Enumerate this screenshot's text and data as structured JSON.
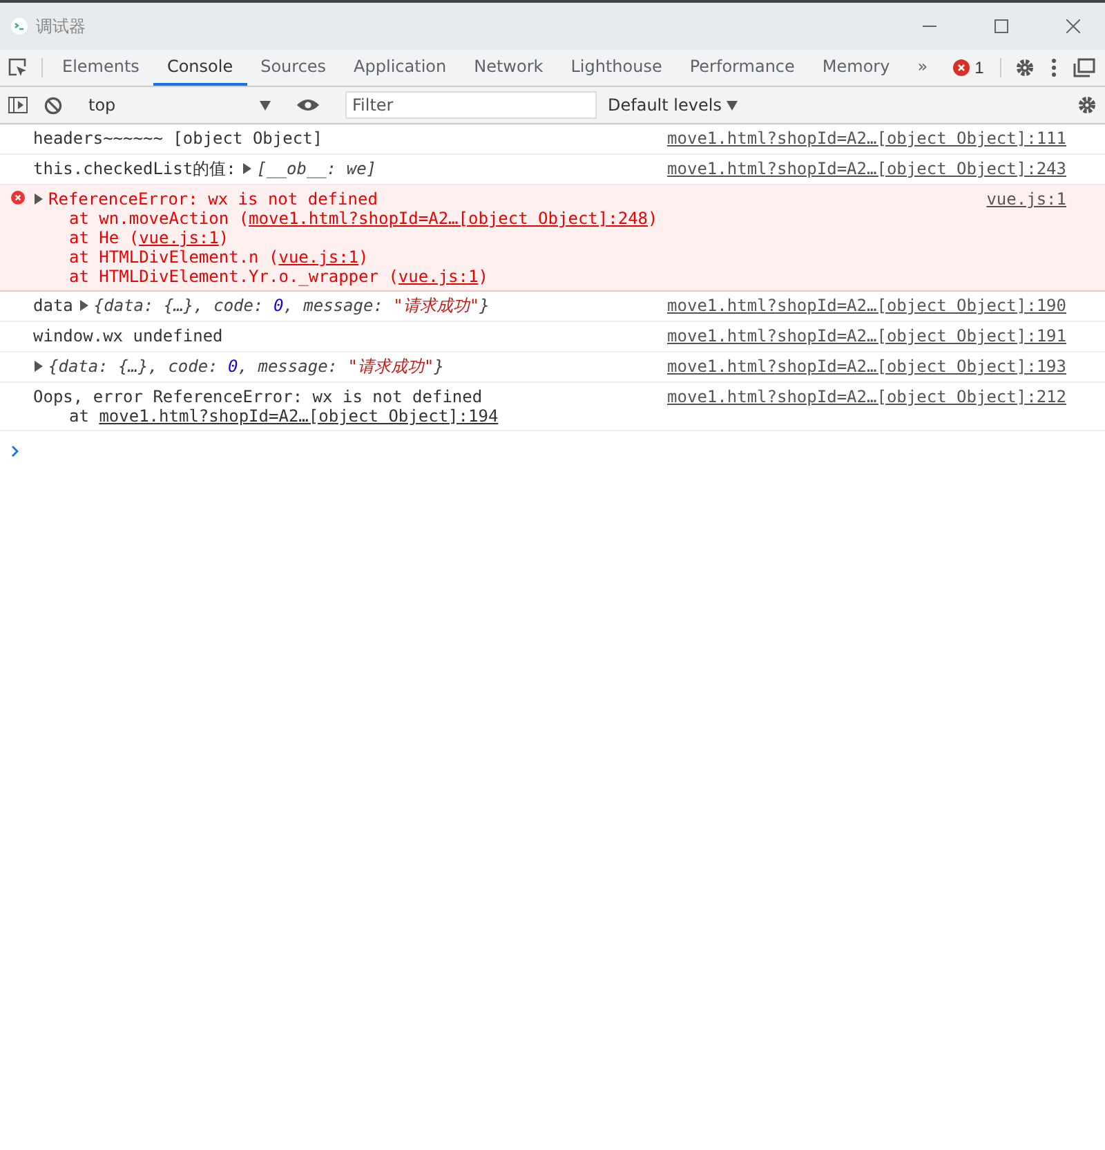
{
  "window": {
    "title": "调试器"
  },
  "tabs": [
    {
      "label": "Elements",
      "selected": false
    },
    {
      "label": "Console",
      "selected": true
    },
    {
      "label": "Sources",
      "selected": false
    },
    {
      "label": "Application",
      "selected": false
    },
    {
      "label": "Network",
      "selected": false
    },
    {
      "label": "Lighthouse",
      "selected": false
    },
    {
      "label": "Performance",
      "selected": false
    },
    {
      "label": "Memory",
      "selected": false
    }
  ],
  "more_tabs": "»",
  "error_count": "1",
  "console_toolbar": {
    "context": "top",
    "filter": {
      "placeholder": "Filter"
    },
    "levels": "Default levels"
  },
  "messages": [
    {
      "error": false,
      "source": "move1.html?shopId=A2…[object Object]:111",
      "lines": [
        [
          {
            "kind": "text",
            "text": "headers~~~~~~ [object Object]"
          }
        ]
      ]
    },
    {
      "error": false,
      "source": "move1.html?shopId=A2…[object Object]:243",
      "lines": [
        [
          {
            "kind": "text",
            "text": "this.checkedList的值:"
          },
          {
            "kind": "expander",
            "expanded": false
          },
          {
            "kind": "preview",
            "text": "[__ob__: we]"
          }
        ]
      ]
    },
    {
      "error": true,
      "source": "vue.js:1",
      "lines": [
        [
          {
            "kind": "expander",
            "expanded": false
          },
          {
            "kind": "text",
            "text": "ReferenceError: wx is not defined"
          }
        ],
        [
          {
            "kind": "text",
            "text": "at wn.moveAction ("
          },
          {
            "kind": "link",
            "text": "move1.html?shopId=A2…[object Object]:248"
          },
          {
            "kind": "text",
            "text": ")"
          }
        ],
        [
          {
            "kind": "text",
            "text": "at He ("
          },
          {
            "kind": "link",
            "text": "vue.js:1"
          },
          {
            "kind": "text",
            "text": ")"
          }
        ],
        [
          {
            "kind": "text",
            "text": "at HTMLDivElement.n ("
          },
          {
            "kind": "link",
            "text": "vue.js:1"
          },
          {
            "kind": "text",
            "text": ")"
          }
        ],
        [
          {
            "kind": "text",
            "text": "at HTMLDivElement.Yr.o._wrapper ("
          },
          {
            "kind": "link",
            "text": "vue.js:1"
          },
          {
            "kind": "text",
            "text": ")"
          }
        ]
      ]
    },
    {
      "error": false,
      "source": "move1.html?shopId=A2…[object Object]:190",
      "lines": [
        [
          {
            "kind": "text",
            "text": "data"
          },
          {
            "kind": "expander",
            "expanded": false
          },
          {
            "kind": "preview",
            "text": "{data: {…}, code: "
          },
          {
            "kind": "number",
            "text": "0"
          },
          {
            "kind": "preview",
            "text": ", message: "
          },
          {
            "kind": "string",
            "text": "\"请求成功\""
          },
          {
            "kind": "preview",
            "text": "}"
          }
        ]
      ]
    },
    {
      "error": false,
      "source": "move1.html?shopId=A2…[object Object]:191",
      "lines": [
        [
          {
            "kind": "text",
            "text": "window.wx undefined"
          }
        ]
      ]
    },
    {
      "error": false,
      "source": "move1.html?shopId=A2…[object Object]:193",
      "lines": [
        [
          {
            "kind": "expander",
            "expanded": false
          },
          {
            "kind": "preview",
            "text": "{data: {…}, code: "
          },
          {
            "kind": "number",
            "text": "0"
          },
          {
            "kind": "preview",
            "text": ", message: "
          },
          {
            "kind": "string",
            "text": "\"请求成功\""
          },
          {
            "kind": "preview",
            "text": "}"
          }
        ]
      ]
    },
    {
      "error": false,
      "source": "move1.html?shopId=A2…[object Object]:212",
      "lines": [
        [
          {
            "kind": "text",
            "text": "Oops, error ReferenceError: wx is not defined"
          }
        ],
        [
          {
            "kind": "text",
            "text": "at "
          },
          {
            "kind": "link",
            "text": "move1.html?shopId=A2…[object Object]:194"
          }
        ]
      ]
    }
  ]
}
